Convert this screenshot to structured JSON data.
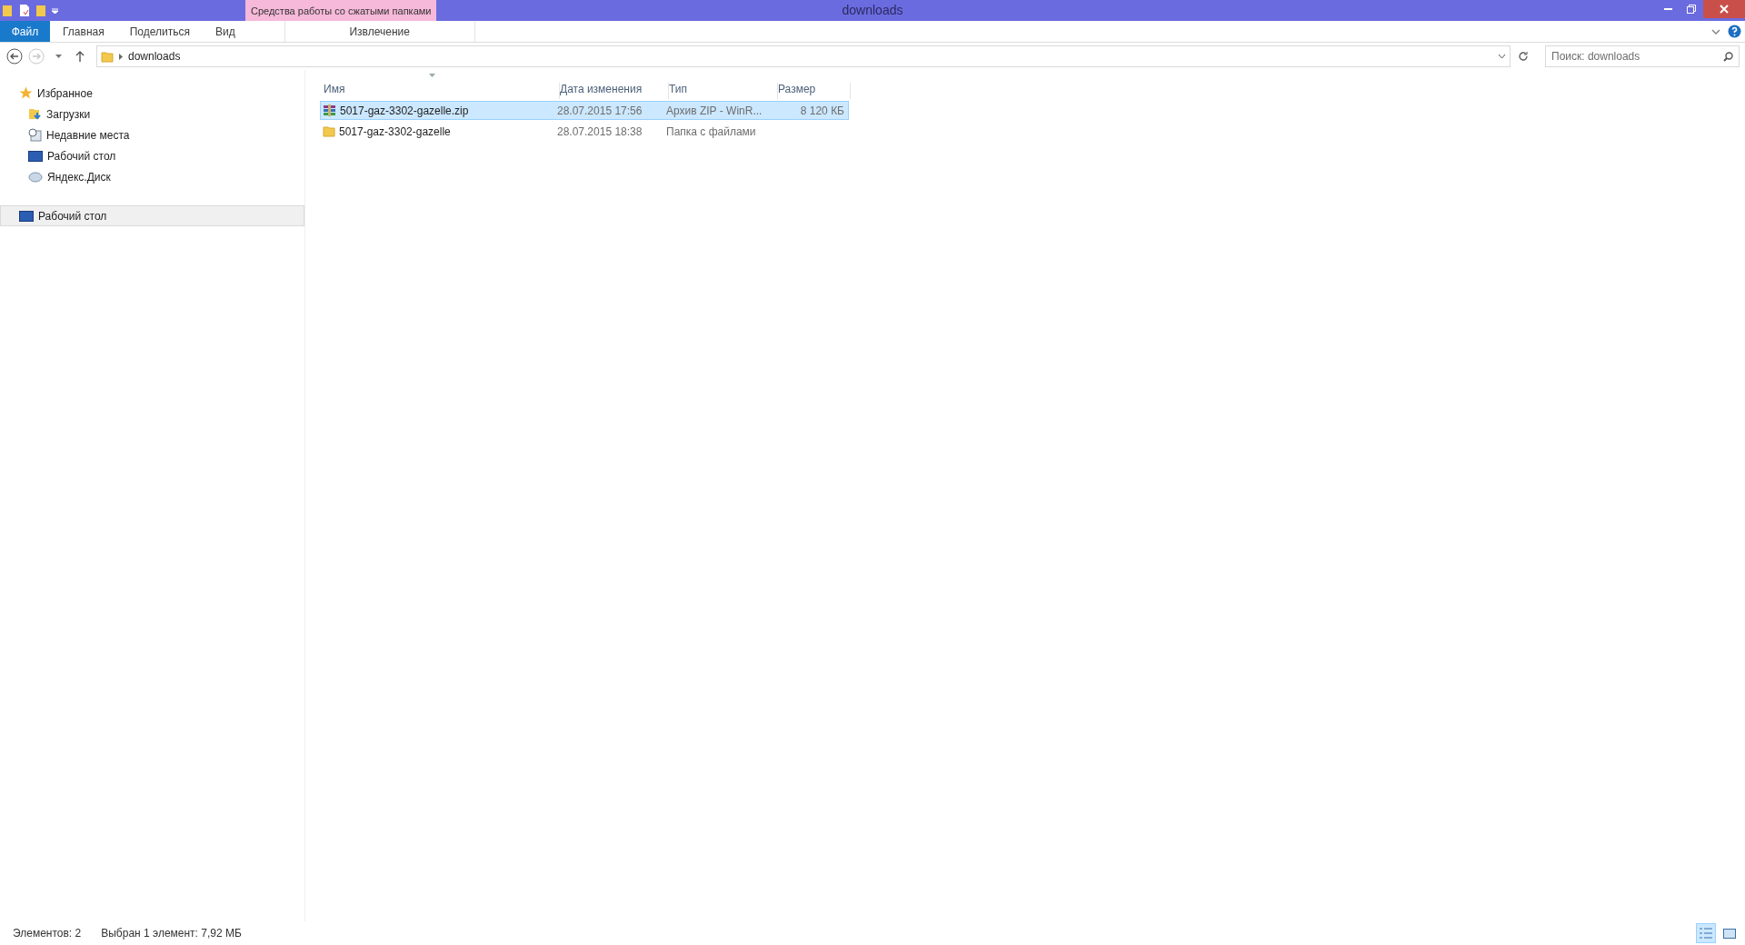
{
  "window": {
    "title": "downloads",
    "contextual_group": "Средства работы со сжатыми папками"
  },
  "ribbon_tabs": [
    {
      "label": "Файл",
      "kind": "file",
      "selected": false
    },
    {
      "label": "Главная",
      "kind": "tab",
      "selected": false
    },
    {
      "label": "Поделиться",
      "kind": "tab",
      "selected": false
    },
    {
      "label": "Вид",
      "kind": "tab",
      "selected": false
    },
    {
      "label": "Извлечение",
      "kind": "contextual",
      "selected": false
    }
  ],
  "address_bar": {
    "path": "downloads"
  },
  "search": {
    "placeholder": "Поиск: downloads"
  },
  "navigation": {
    "favorites": {
      "label": "Избранное",
      "selected": false,
      "children": [
        {
          "label": "Загрузки",
          "kind": "downloads",
          "selected": false
        },
        {
          "label": "Недавние места",
          "kind": "recent",
          "selected": false
        },
        {
          "label": "Рабочий стол",
          "kind": "desktop",
          "selected": false
        },
        {
          "label": "Яндекс.Диск",
          "kind": "cloud",
          "selected": false
        }
      ]
    },
    "desktop": {
      "label": "Рабочий стол",
      "selected": true
    }
  },
  "columns": [
    "Имя",
    "Дата изменения",
    "Тип",
    "Размер"
  ],
  "rows": [
    {
      "kind": "archive",
      "name": "5017-gaz-3302-gazelle.zip",
      "date": "28.07.2015 17:56",
      "type": "Архив ZIP - WinR...",
      "size": "8 120 КБ",
      "selected": true
    },
    {
      "kind": "folder",
      "name": "5017-gaz-3302-gazelle",
      "date": "28.07.2015 18:38",
      "type": "Папка с файлами",
      "size": "",
      "selected": false
    }
  ],
  "status_bar": {
    "items": "Элементов: 2",
    "selection": "Выбран 1 элемент: 7,92 МБ"
  },
  "view_buttons": [
    {
      "kind": "details",
      "selected": true
    },
    {
      "kind": "large-icons",
      "selected": false
    }
  ]
}
